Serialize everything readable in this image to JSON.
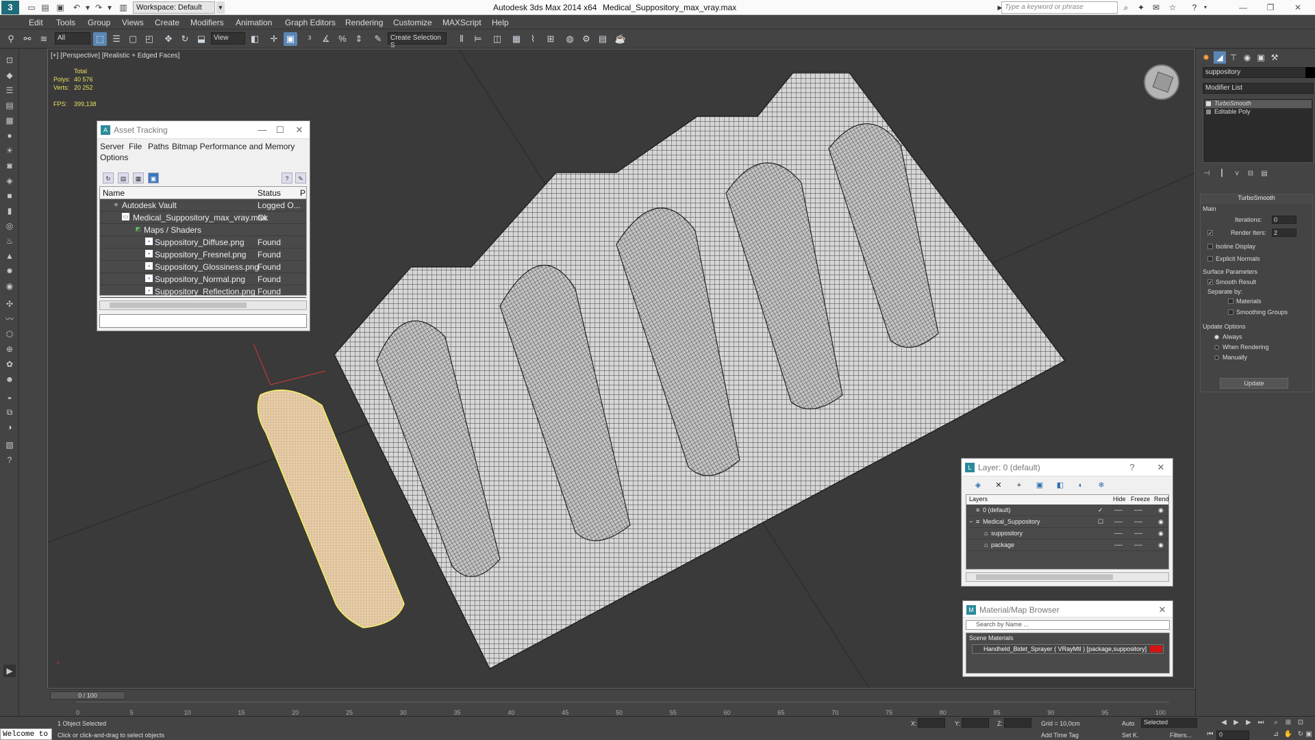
{
  "titlebar": {
    "logo": "3",
    "workspace": "Workspace: Default",
    "app_title": "Autodesk 3ds Max  2014 x64",
    "file_title": "Medical_Suppository_max_vray.max",
    "search_placeholder": "Type a keyword or phrase"
  },
  "menu": [
    "Edit",
    "Tools",
    "Group",
    "Views",
    "Create",
    "Modifiers",
    "Animation",
    "Graph Editors",
    "Rendering",
    "Customize",
    "MAXScript",
    "Help"
  ],
  "toolbar": {
    "filter": "All",
    "ref_coord": "View",
    "selection_set": "Create Selection S"
  },
  "viewport": {
    "label": "[+] [Perspective] [Realistic + Edged Faces]",
    "stats_total": "Total",
    "polys_label": "Polys:",
    "polys_value": "40 576",
    "verts_label": "Verts:",
    "verts_value": "20 252",
    "fps_label": "FPS:",
    "fps_value": "399,138"
  },
  "asset_tracking": {
    "title": "Asset Tracking",
    "menu": [
      "Server",
      "File",
      "Paths",
      "Bitmap Performance and Memory",
      "Options"
    ],
    "col_name": "Name",
    "col_status": "Status",
    "col_p": "P",
    "rows": [
      {
        "name": "Autodesk Vault",
        "status": "Logged O..."
      },
      {
        "name": "Medical_Suppository_max_vray.max",
        "status": "Ok"
      },
      {
        "name": "Maps / Shaders",
        "status": ""
      },
      {
        "name": "Suppository_Diffuse.png",
        "status": "Found"
      },
      {
        "name": "Suppository_Fresnel.png",
        "status": "Found"
      },
      {
        "name": "Suppository_Glossiness.png",
        "status": "Found"
      },
      {
        "name": "Suppository_Normal.png",
        "status": "Found"
      },
      {
        "name": "Suppository_Reflection.png",
        "status": "Found"
      }
    ]
  },
  "command_panel": {
    "object_name": "suppository",
    "modifier_list": "Modifier List",
    "stack": [
      "TurboSmooth",
      "Editable Poly"
    ],
    "rollout_title": "TurboSmooth",
    "main": "Main",
    "iterations_label": "Iterations:",
    "iterations_value": "0",
    "render_iters_label": "Render Iters:",
    "render_iters_value": "2",
    "isoline": "Isoline Display",
    "explicit_normals": "Explicit Normals",
    "surface_params": "Surface Parameters",
    "smooth_result": "Smooth Result",
    "separate_by": "Separate by:",
    "materials": "Materials",
    "smoothing_groups": "Smoothing Groups",
    "update_options": "Update Options",
    "always": "Always",
    "when_rendering": "When Rendering",
    "manually": "Manually",
    "update_btn": "Update"
  },
  "layer_panel": {
    "title": "Layer: 0 (default)",
    "col_layers": "Layers",
    "col_hide": "Hide",
    "col_freeze": "Freeze",
    "col_render": "Rend",
    "rows": [
      {
        "name": "0 (default)",
        "dash1": "----",
        "dash2": "----"
      },
      {
        "name": "Medical_Suppository",
        "dash1": "----",
        "dash2": "----"
      },
      {
        "name": "suppository",
        "dash1": "----",
        "dash2": "----"
      },
      {
        "name": "package",
        "dash1": "----",
        "dash2": "----"
      }
    ]
  },
  "material_browser": {
    "title": "Material/Map Browser",
    "search_placeholder": "Search by Name ...",
    "group": "Scene Materials",
    "item": "Handheld_Bidet_Sprayer  ( VRayMtl )  [package,suppository]"
  },
  "timeline": {
    "frame": "0 / 100",
    "ticks": [
      "0",
      "5",
      "10",
      "15",
      "20",
      "25",
      "30",
      "35",
      "40",
      "45",
      "50",
      "55",
      "60",
      "65",
      "70",
      "75",
      "80",
      "85",
      "90",
      "95",
      "100"
    ]
  },
  "status": {
    "welcome": "Welcome to",
    "selected": "1 Object Selected",
    "prompt": "Click or click-and-drag to select objects",
    "x_label": "X:",
    "y_label": "Y:",
    "z_label": "Z:",
    "grid": "Grid = 10,0cm",
    "add_time_tag": "Add Time Tag",
    "auto": "Auto",
    "set_key": "Set K.",
    "selected_dropdown": "Selected",
    "filters": "Filters...",
    "frame_value": "0"
  }
}
